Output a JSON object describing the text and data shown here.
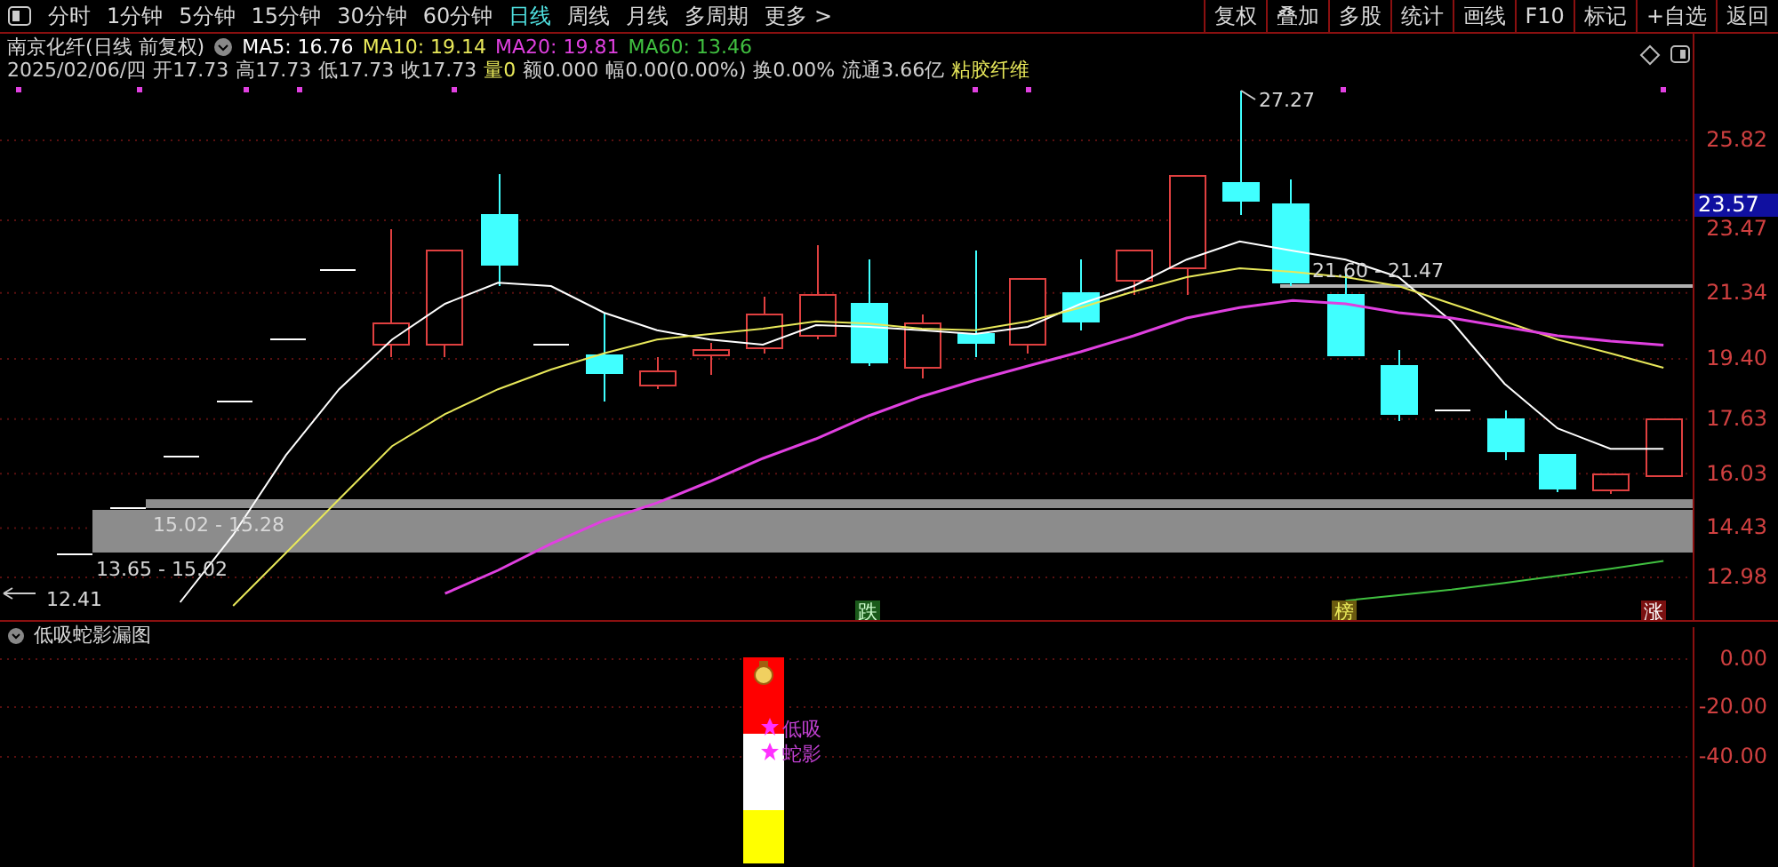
{
  "toolbar": {
    "period_tabs": [
      {
        "label": "分时",
        "selected": false
      },
      {
        "label": "1分钟",
        "selected": false
      },
      {
        "label": "5分钟",
        "selected": false
      },
      {
        "label": "15分钟",
        "selected": false
      },
      {
        "label": "30分钟",
        "selected": false
      },
      {
        "label": "60分钟",
        "selected": false
      },
      {
        "label": "日线",
        "selected": true
      },
      {
        "label": "周线",
        "selected": false
      },
      {
        "label": "月线",
        "selected": false
      },
      {
        "label": "多周期",
        "selected": false
      },
      {
        "label": "更多 >",
        "selected": false
      }
    ],
    "buttons": [
      "复权",
      "叠加",
      "多股",
      "统计",
      "画线",
      "F10",
      "标记",
      "+自选",
      "返回"
    ]
  },
  "main_chart": {
    "title": "南京化纤(日线 前复权)",
    "quote": [
      {
        "text": "2025/02/06/四",
        "color": "#d0d0d0"
      },
      {
        "text": "开17.73",
        "color": "#d0d0d0"
      },
      {
        "text": "高17.73",
        "color": "#d0d0d0"
      },
      {
        "text": "低17.73",
        "color": "#d0d0d0"
      },
      {
        "text": "收17.73",
        "color": "#d0d0d0"
      },
      {
        "text": "量0",
        "color": "#e8e85a"
      },
      {
        "text": "额0.000",
        "color": "#d0d0d0"
      },
      {
        "text": "幅0.00(0.00%)",
        "color": "#d0d0d0"
      },
      {
        "text": "换0.00%",
        "color": "#d0d0d0"
      },
      {
        "text": "流通3.66亿",
        "color": "#d0d0d0"
      },
      {
        "text": "粘胶纤维",
        "color": "#e8e85a"
      }
    ],
    "price_labels": [
      "27.27",
      "21.60 - 21.47",
      "15.02 - 15.28",
      "13.65 - 15.02",
      "12.41"
    ],
    "markers": [
      {
        "kind": "fall",
        "label": "跌"
      },
      {
        "kind": "list",
        "label": "榜"
      },
      {
        "kind": "rise",
        "label": "涨"
      }
    ],
    "current_price": "23.57",
    "chart_data": {
      "type": "line",
      "categories": [
        null,
        null,
        null,
        null,
        null,
        null,
        null,
        null,
        null,
        null,
        null,
        null,
        null,
        null,
        null,
        null,
        null,
        null,
        null,
        null,
        null,
        null,
        null,
        null,
        null,
        null,
        null,
        null,
        null,
        null,
        null,
        null
      ],
      "ylim": [
        11.73,
        28.95
      ],
      "grid": true,
      "yticks": [
        {
          "value": 25.82,
          "label": "25.82"
        },
        {
          "value": 23.47,
          "label": "23.47"
        },
        {
          "value": 21.34,
          "label": "21.34"
        },
        {
          "value": 19.4,
          "label": "19.40"
        },
        {
          "value": 17.63,
          "label": "17.63"
        },
        {
          "value": 16.03,
          "label": "16.03"
        },
        {
          "value": 14.43,
          "label": "14.43"
        },
        {
          "value": 12.98,
          "label": "12.98"
        }
      ],
      "series": [
        {
          "name": "MA5: 16.76",
          "color": "#ffffff",
          "values": [
            null,
            null,
            null,
            12.25,
            14.23,
            16.58,
            18.51,
            19.97,
            21.02,
            21.64,
            21.54,
            20.76,
            20.24,
            19.97,
            19.82,
            20.39,
            20.34,
            20.24,
            20.13,
            20.34,
            21.02,
            21.54,
            22.32,
            22.85,
            22.58,
            22.32,
            21.8,
            20.5,
            18.67,
            17.36,
            16.76,
            16.76
          ]
        },
        {
          "name": "MA10: 19.14",
          "color": "#e8e85a",
          "values": [
            null,
            null,
            null,
            null,
            12.15,
            13.71,
            15.28,
            16.84,
            17.78,
            18.51,
            19.09,
            19.56,
            19.97,
            20.13,
            20.29,
            20.5,
            20.44,
            20.29,
            20.24,
            20.5,
            20.91,
            21.38,
            21.8,
            22.06,
            21.96,
            21.8,
            21.54,
            21.02,
            20.5,
            19.97,
            19.56,
            19.14
          ]
        },
        {
          "name": "MA20: 19.81",
          "color": "#e040e0",
          "values": [
            null,
            null,
            null,
            null,
            null,
            null,
            null,
            null,
            12.51,
            13.19,
            13.97,
            14.65,
            15.17,
            15.8,
            16.48,
            17.05,
            17.73,
            18.3,
            18.77,
            19.19,
            19.61,
            20.08,
            20.6,
            20.91,
            21.12,
            21.02,
            20.76,
            20.6,
            20.34,
            20.08,
            19.92,
            19.81
          ]
        },
        {
          "name": "MA60: 13.46",
          "color": "#40c040",
          "values": [
            null,
            null,
            null,
            null,
            null,
            null,
            null,
            null,
            null,
            null,
            null,
            null,
            null,
            null,
            null,
            null,
            null,
            null,
            null,
            null,
            null,
            null,
            null,
            null,
            null,
            12.3,
            12.46,
            12.62,
            12.82,
            13.03,
            13.24,
            13.46
          ]
        }
      ]
    }
  },
  "sub_chart": {
    "title": "低吸蛇影漏图",
    "signals": [
      "低吸",
      "蛇影"
    ],
    "axis_labels": [
      "0.00",
      "-20.00",
      "-40.00"
    ]
  }
}
